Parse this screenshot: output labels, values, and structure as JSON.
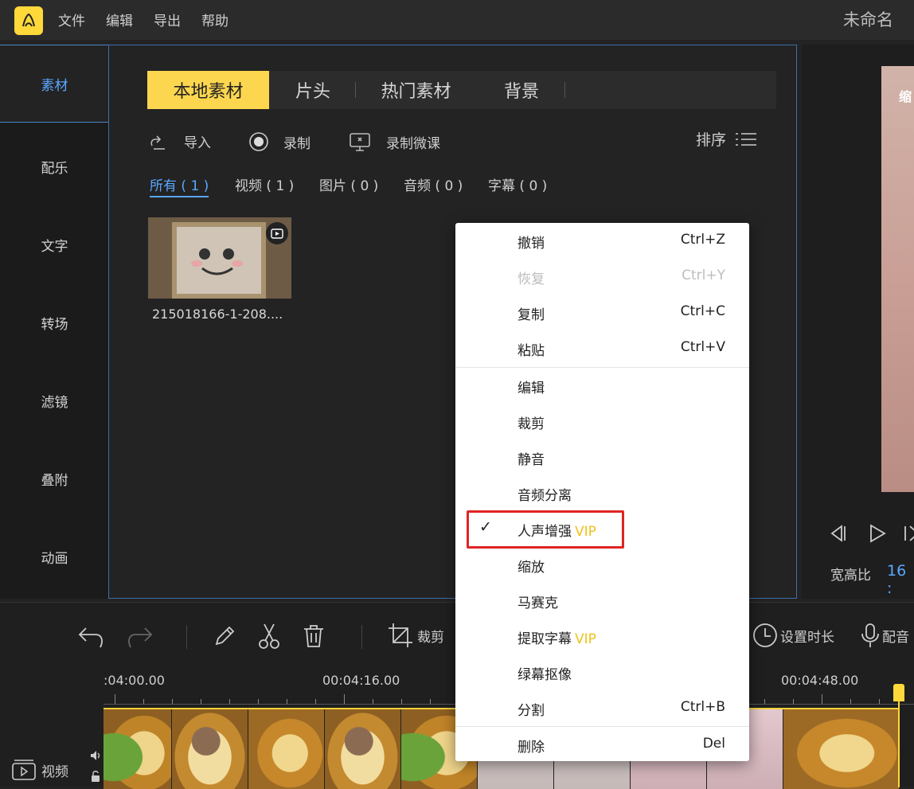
{
  "titlebar": {
    "menu": [
      "文件",
      "编辑",
      "导出",
      "帮助"
    ],
    "doc_title": "未命名"
  },
  "sidebar": {
    "items": [
      {
        "label": "素材",
        "active": true
      },
      {
        "label": "配乐"
      },
      {
        "label": "文字"
      },
      {
        "label": "转场"
      },
      {
        "label": "滤镜"
      },
      {
        "label": "叠附"
      },
      {
        "label": "动画"
      }
    ]
  },
  "panel": {
    "tabs": [
      "本地素材",
      "片头",
      "热门素材",
      "背景"
    ],
    "tools": {
      "import": "导入",
      "record": "录制",
      "record_lesson": "录制微课"
    },
    "sort": "排序",
    "filters": [
      "所有 ( 1 )",
      "视频 ( 1 )",
      "图片 ( 0 )",
      "音频 ( 0 )",
      "字幕 ( 0 )"
    ],
    "media": {
      "caption": "215018166-1-208...."
    }
  },
  "preview": {
    "overlay_text": "缩",
    "ratio_label": "宽高比",
    "ratio_value": "16 :"
  },
  "timeline": {
    "tools": {
      "crop": "裁剪",
      "set_duration": "设置时长",
      "dub": "配音"
    },
    "times": [
      ":04:00.00",
      "00:04:16.00",
      "00:04:48.00"
    ],
    "track_label": "视频"
  },
  "context_menu": {
    "items": [
      {
        "label": "撤销",
        "shortcut": "Ctrl+Z"
      },
      {
        "label": "恢复",
        "shortcut": "Ctrl+Y",
        "disabled": true
      },
      {
        "label": "复制",
        "shortcut": "Ctrl+C"
      },
      {
        "label": "粘贴",
        "shortcut": "Ctrl+V"
      },
      {
        "label": "编辑"
      },
      {
        "label": "裁剪"
      },
      {
        "label": "静音"
      },
      {
        "label": "音频分离"
      },
      {
        "label": "人声增强",
        "vip": "VIP",
        "checked": true
      },
      {
        "label": "缩放"
      },
      {
        "label": "马赛克"
      },
      {
        "label": "提取字幕",
        "vip": "VIP"
      },
      {
        "label": "绿幕抠像"
      },
      {
        "label": "分割",
        "shortcut": "Ctrl+B"
      },
      {
        "label": "删除",
        "shortcut": "Del"
      }
    ]
  },
  "colors": {
    "accent_yellow": "#fcd64e",
    "accent_blue": "#5aa7ff",
    "highlight_red": "#e02424",
    "vip": "#f0c21b"
  }
}
